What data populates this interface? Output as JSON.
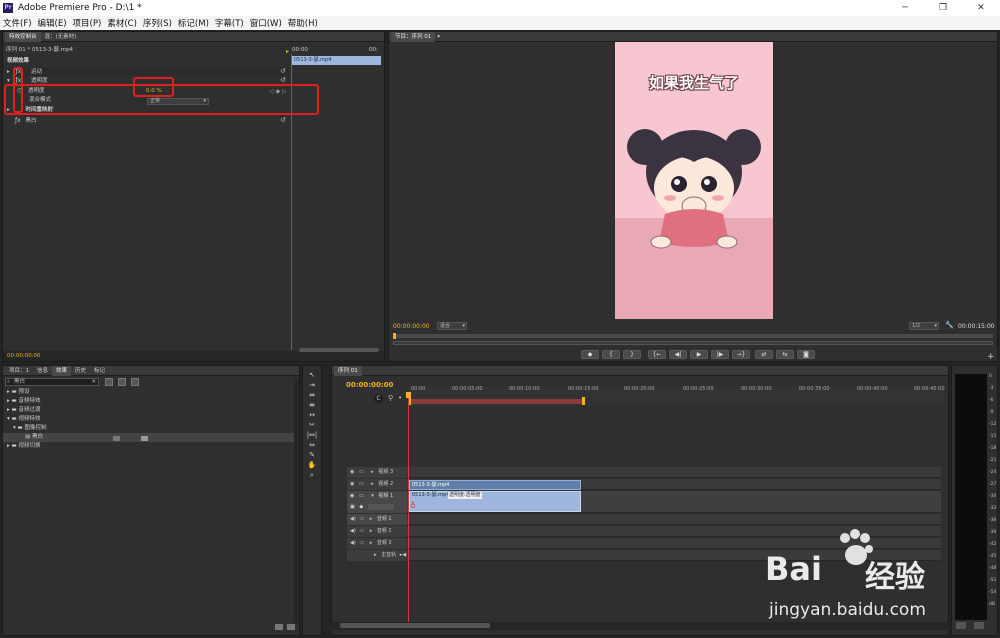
{
  "window": {
    "title": "Adobe Premiere Pro - D:\\1 *",
    "logo": "Pr",
    "minimize": "─",
    "maximize": "❐",
    "close": "✕"
  },
  "menu": [
    "文件(F)",
    "编辑(E)",
    "项目(P)",
    "素材(C)",
    "序列(S)",
    "标记(M)",
    "字幕(T)",
    "窗口(W)",
    "帮助(H)"
  ],
  "effect_controls": {
    "tabs": [
      "特效控制台",
      "混：(无素材)"
    ],
    "sequence_label": "序列 01 * 0513-3-瑟.mp4",
    "ruler_start": "00:00",
    "ruler_end": "00:",
    "clip_name": "0513-3-瑟.mp4",
    "section": "视频效果",
    "motion": "运动",
    "opacity": "透明度",
    "opacity_prop": "透明度",
    "opacity_value": "0.0 %",
    "blend_mode_label": "混合模式",
    "blend_mode_value": "正常",
    "time_remap": "时间重映射",
    "black_white": "黑白",
    "timecode": "00:00:00:00"
  },
  "program": {
    "tabs": [
      "节目：序列 01"
    ],
    "caption": "如果我生气了",
    "timecode_left": "00:00:00:00",
    "fit": "适合",
    "ratio": "1/2",
    "timecode_right": "00:00:15:00",
    "transport": [
      "◆",
      "{",
      "}",
      "{←",
      "◀|",
      "▶",
      "|▶",
      "→}",
      "⇄",
      "⇆",
      "◙"
    ],
    "add": "+"
  },
  "project": {
    "tabs": [
      "项目：1",
      "信息",
      "效果",
      "历史",
      "标记"
    ],
    "search_value": "黑白",
    "tree": [
      {
        "label": "预设",
        "indent": 0
      },
      {
        "label": "音频特效",
        "indent": 0
      },
      {
        "label": "音频过渡",
        "indent": 0
      },
      {
        "label": "视频特效",
        "indent": 0
      },
      {
        "label": "图像控制",
        "indent": 1
      },
      {
        "label": "黑白",
        "indent": 2
      },
      {
        "label": "视频切换",
        "indent": 0
      }
    ]
  },
  "timeline": {
    "tab": "序列 01",
    "timecode": "00:00:00:00",
    "ticks": [
      "00:00",
      "00:00:05:00",
      "00:00:10:00",
      "00:00:15:00",
      "00:00:20:00",
      "00:00:25:00",
      "00:00:30:00",
      "00:00:35:00",
      "00:00:40:00",
      "00:00:45:00"
    ],
    "tracks": [
      {
        "name": "视频 3"
      },
      {
        "name": "视频 2"
      },
      {
        "name": "视频 1"
      },
      {
        "name": "音频 1"
      },
      {
        "name": "音频 2"
      },
      {
        "name": "音频 3"
      },
      {
        "name": "主音轨"
      }
    ],
    "clip_v2": "0513-3-瑟.mp4",
    "clip_v1": "0513-3-瑟.mp4",
    "clip_v1_fx": "透明度:透明度"
  },
  "audio_meter": {
    "scale": [
      "0",
      "-3",
      "-6",
      "-9",
      "-12",
      "-15",
      "-18",
      "-21",
      "-24",
      "-27",
      "-30",
      "-33",
      "-36",
      "-39",
      "-42",
      "-45",
      "-48",
      "-51",
      "-54",
      "dB"
    ]
  },
  "watermark": {
    "brand": "Bai",
    "brand2": "经验",
    "url": "jingyan.baidu.com"
  },
  "colors": {
    "playhead": "#d23a3a",
    "timecode": "#f0b21e",
    "video_bg": "#f7c6d0",
    "highlight": "#e02020"
  }
}
